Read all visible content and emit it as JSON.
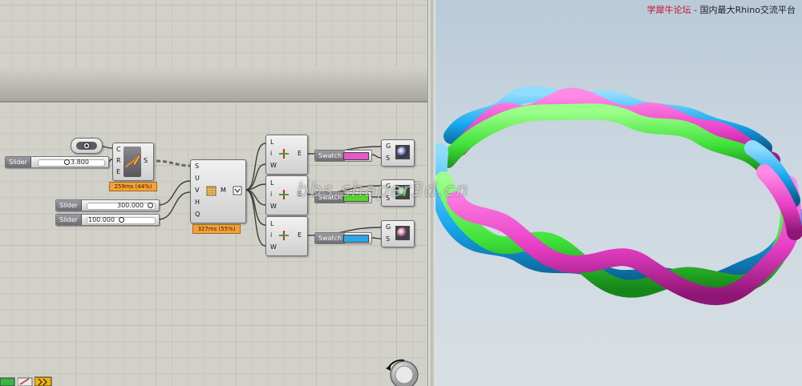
{
  "site": {
    "title_cn": "学犀牛论坛",
    "separator": "-",
    "subtitle_cn": "国内最大Rhino交流平台",
    "watermark": "bbs.shaper3d.cn"
  },
  "canvas": {
    "sliders": [
      {
        "label": "Slider",
        "value": "3.800"
      },
      {
        "label": "Slider",
        "value": "300.000"
      },
      {
        "label": "Slider",
        "value": "100.000"
      }
    ],
    "curve_component": {
      "inputs": [
        "C",
        "R",
        "E"
      ],
      "output": "S",
      "timer": "259ms (44%)"
    },
    "surface_component": {
      "inputs": [
        "S",
        "U",
        "V",
        "H",
        "Q"
      ],
      "output": "M",
      "timer": "327ms (55%)"
    },
    "pipe_components": [
      {
        "inputs": [
          "L",
          "i",
          "W"
        ],
        "output": "E"
      },
      {
        "inputs": [
          "L",
          "i",
          "W"
        ],
        "output": "E"
      },
      {
        "inputs": [
          "L",
          "i",
          "W"
        ],
        "output": "E"
      }
    ],
    "swatches": [
      {
        "label": "Swatch",
        "color": "#e45ac8"
      },
      {
        "label": "Swatch",
        "color": "#59d431"
      },
      {
        "label": "Swatch",
        "color": "#2ea6e6"
      }
    ],
    "preview_components": [
      {
        "inputs": [
          "G",
          "S"
        ]
      },
      {
        "inputs": [
          "G",
          "S"
        ]
      },
      {
        "inputs": [
          "G",
          "S"
        ]
      }
    ]
  },
  "colors": {
    "strand_magenta": "#e83fc6",
    "strand_green": "#3fe23a",
    "strand_cyan": "#17a8ee",
    "timer_orange": "#f2a23a"
  },
  "icons": {
    "toggle": "eye-toggle-icon",
    "curve": "pencil-curve-icon",
    "surface": "surface-icon",
    "preview": "shaded-sphere-icon",
    "nav": "navigation-wheel-icon"
  }
}
